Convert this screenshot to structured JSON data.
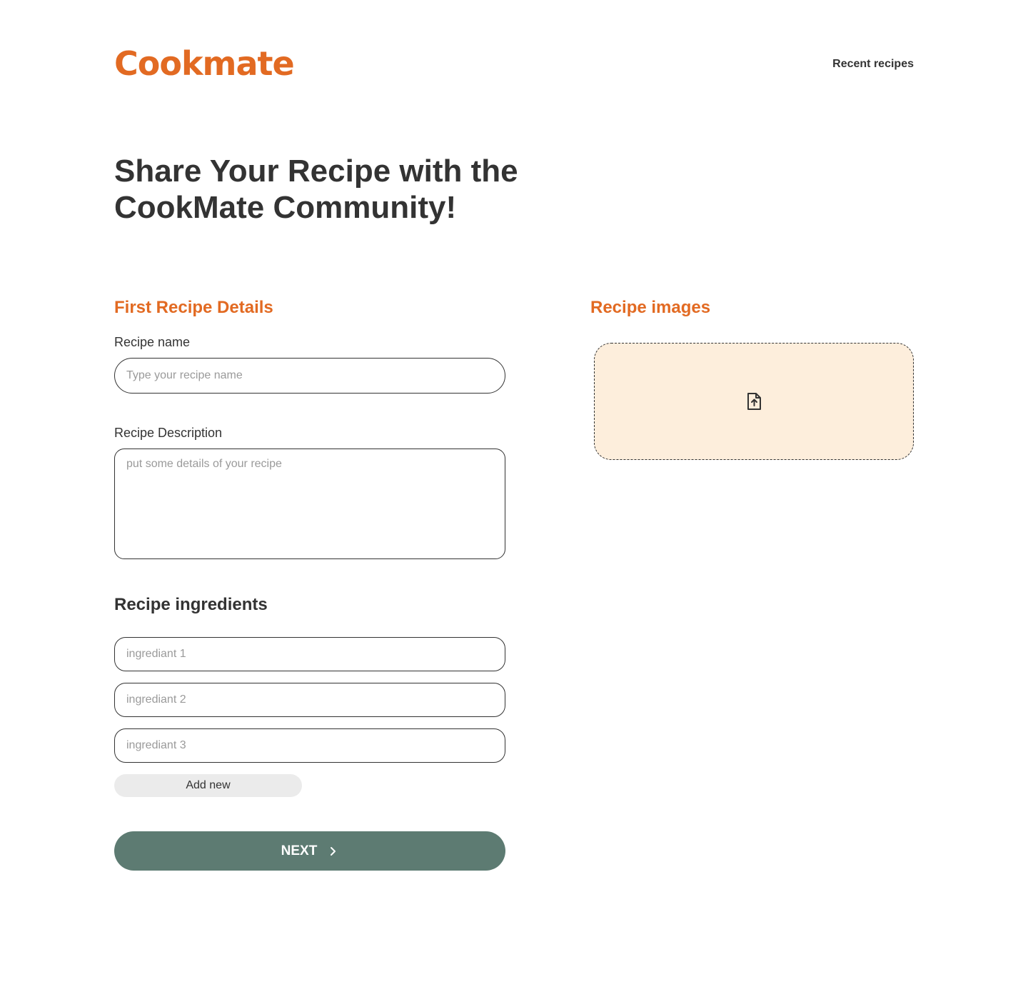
{
  "header": {
    "logo": "Cookmate",
    "nav_recent": "Recent recipes"
  },
  "page": {
    "title": "Share Your Recipe with the CookMate Community!"
  },
  "details": {
    "section_title": "First Recipe Details",
    "name_label": "Recipe name",
    "name_placeholder": "Type your recipe name",
    "description_label": "Recipe Description",
    "description_placeholder": "put some details of your recipe"
  },
  "ingredients": {
    "title": "Recipe ingredients",
    "placeholders": [
      "ingrediant 1",
      "ingrediant 2",
      "ingrediant 3"
    ],
    "add_label": "Add new"
  },
  "images": {
    "section_title": "Recipe images",
    "upload_icon": "file-upload-icon"
  },
  "actions": {
    "next_label": "NEXT",
    "next_icon": "chevron-right-icon"
  },
  "colors": {
    "brand": "#E26A22",
    "primary_button": "#5D7B72",
    "dropzone_bg": "#FDEEDC",
    "text": "#333333"
  }
}
